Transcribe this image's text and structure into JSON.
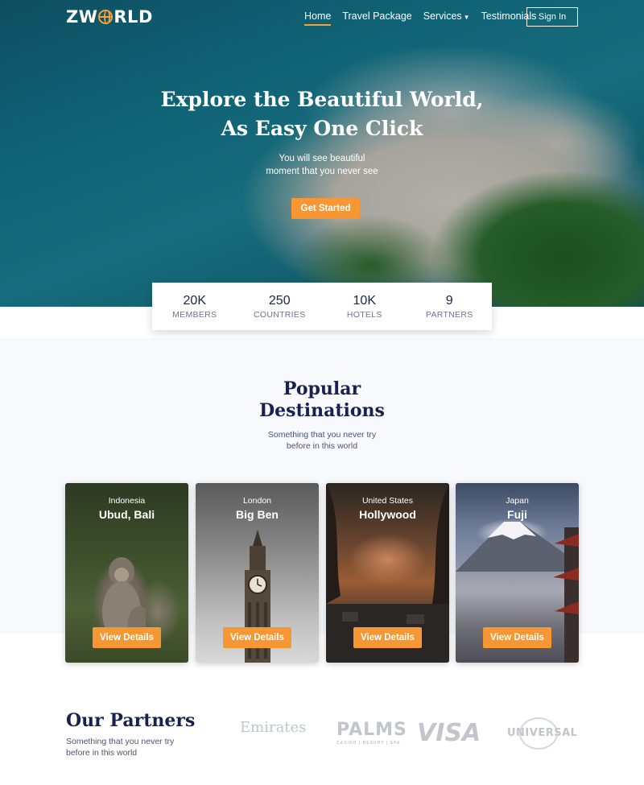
{
  "brand": {
    "logo_left": "ZW",
    "logo_right": "RLD",
    "logo_icon": "globe-icon"
  },
  "nav": {
    "items": [
      {
        "label": "Home",
        "active": true
      },
      {
        "label": "Travel Package"
      },
      {
        "label": "Services",
        "has_dropdown": true
      },
      {
        "label": "Testimonials"
      }
    ],
    "signin_label": "Sign In"
  },
  "hero": {
    "title_line1": "Explore the Beautiful World,",
    "title_line2": "As Easy One Click",
    "subtitle_line1": "You will see beautiful",
    "subtitle_line2": "moment that you never see",
    "cta_label": "Get Started"
  },
  "stats": [
    {
      "value": "20K",
      "label": "MEMBERS"
    },
    {
      "value": "250",
      "label": "COUNTRIES"
    },
    {
      "value": "10K",
      "label": "HOTELS"
    },
    {
      "value": "9",
      "label": "PARTNERS"
    }
  ],
  "popular": {
    "title_line1": "Popular",
    "title_line2": "Destinations",
    "subtitle_line1": "Something that you never try",
    "subtitle_line2": "before in this world",
    "cards": [
      {
        "country": "Indonesia",
        "city": "Ubud, Bali",
        "button": "View Details"
      },
      {
        "country": "London",
        "city": "Big Ben",
        "button": "View Details"
      },
      {
        "country": "United States",
        "city": "Hollywood",
        "button": "View Details"
      },
      {
        "country": "Japan",
        "city": "Fuji",
        "button": "View Details"
      }
    ]
  },
  "partners": {
    "title": "Our Partners",
    "subtitle_line1": "Something that you never try",
    "subtitle_line2": "before in this world",
    "logos": [
      {
        "name": "Emirates"
      },
      {
        "name": "PALMS",
        "tagline": "CASINO | RESORT | SPA"
      },
      {
        "name": "VISA"
      },
      {
        "name": "UNIVERSAL"
      }
    ]
  },
  "colors": {
    "accent": "#f79733",
    "navy": "#1a2150",
    "muted": "#4b5375"
  }
}
